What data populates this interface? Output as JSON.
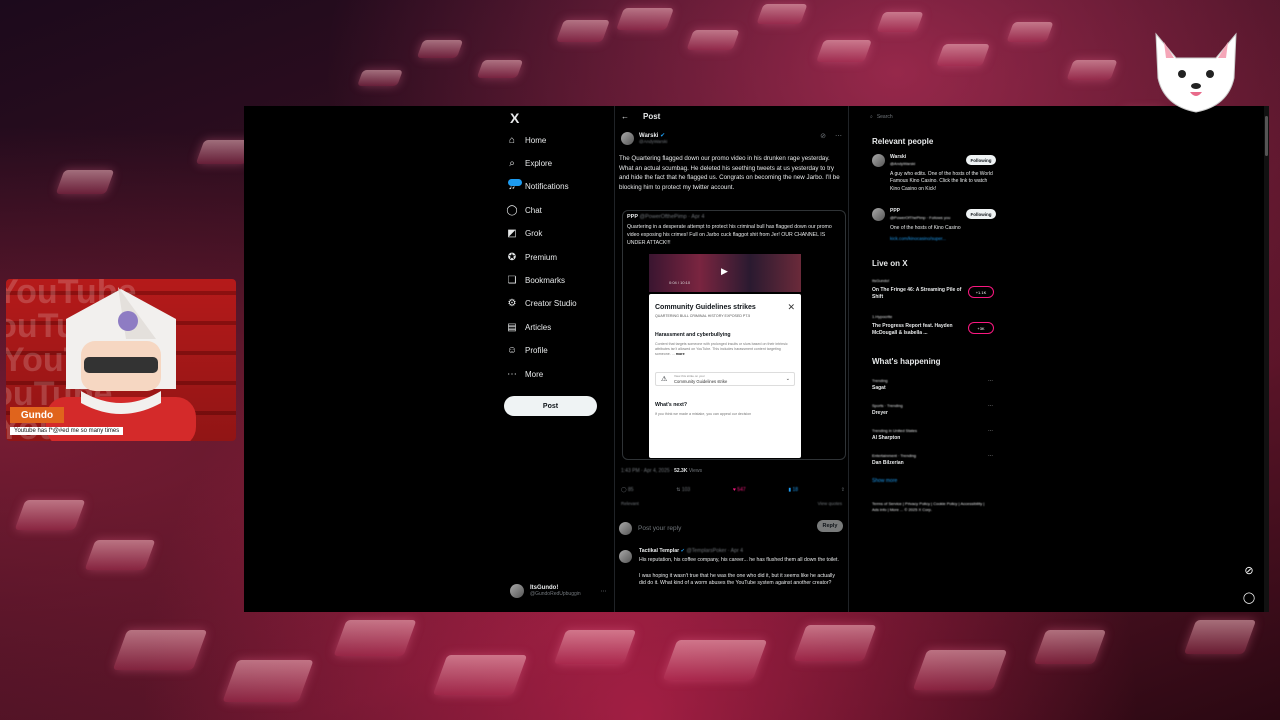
{
  "nav": {
    "logo": "X",
    "items": [
      {
        "label": "Home",
        "icon": "home-icon",
        "glyph": "⌂"
      },
      {
        "label": "Explore",
        "icon": "search-icon",
        "glyph": "⌕"
      },
      {
        "label": "Notifications",
        "icon": "bell-icon",
        "glyph": "♫"
      },
      {
        "label": "Chat",
        "icon": "chat-icon",
        "glyph": "◯"
      },
      {
        "label": "Grok",
        "icon": "grok-icon",
        "glyph": "◩"
      },
      {
        "label": "Premium",
        "icon": "premium-icon",
        "glyph": "✪"
      },
      {
        "label": "Bookmarks",
        "icon": "bookmark-icon",
        "glyph": "❏"
      },
      {
        "label": "Creator Studio",
        "icon": "creator-studio-icon",
        "glyph": "⚙"
      },
      {
        "label": "Articles",
        "icon": "articles-icon",
        "glyph": "▤"
      },
      {
        "label": "Profile",
        "icon": "profile-icon",
        "glyph": "☺"
      },
      {
        "label": "More",
        "icon": "more-icon",
        "glyph": "⋯"
      }
    ],
    "post_label": "Post",
    "account_name": "ItsGundo!",
    "account_handle": "@GundoRedUpbuggin"
  },
  "post": {
    "header": "Post",
    "author_name": "Warski",
    "author_handle": "@AndyWarski",
    "text": "The Quartering flagged down our promo video in his drunken rage yesterday. What an actual scumbag. He deleted his seething tweets at us yesterday to try and hide the fact that he flagged us. Congrats on becoming the new Jarbo. I'll be blocking him to protect my twitter account.",
    "quote_author": "PPP",
    "quote_handle": "@PowerOfthePimp · Apr 4",
    "quote_text": "Quartering in a desperate attempt to protect his criminal bull has flagged down our promo video exposing his crimes! Full on Jarbo cuck flaggot shit from Jer! OUR CHANNEL IS UNDER ATTACK!!!",
    "video_time": "0:04 / 10:10",
    "modal_title": "Community Guidelines strikes",
    "modal_subtitle": "QUARTERING BULL CRIMINAL HISTORY EXPOSED PT.5",
    "modal_section": "Harassment and cyberbullying",
    "modal_body": "Content that targets someone with prolonged insults or slurs based on their intrinsic attributes isn't allowed on YouTube. This includes harassment content targeting someone. ...",
    "modal_more": "more",
    "strike_label": "Community Guidelines strike",
    "strike_sublabel": "View this strike on your",
    "whats_next": "What's next?",
    "whats_next_body": "If you think we made a mistake, you can appeal our decision",
    "timestamp": "1:43 PM · Apr 4, 2025 · ",
    "views": "52.3K",
    "views_label": "Views",
    "stats": {
      "replies": "85",
      "reposts": "103",
      "likes": "547",
      "bookmarks": "18"
    },
    "relevant": "Relevant",
    "view_quotes": "View quotes",
    "reply_placeholder": "Post your reply",
    "reply_label": "Reply"
  },
  "reply": {
    "author": "Tactikal Templar",
    "handle": "@TemplarsPoker · Apr 4",
    "line1": "His reputation, his coffee company, his career... he has flushed them all down the toilet.",
    "line2": "I was hoping it wasn't true that he was the one who did it, but it seems like he actually did do it. What kind of a worm abuses the YouTube system against another creator?"
  },
  "sidebar": {
    "search_placeholder": "Search",
    "relevant_title": "Relevant people",
    "people": [
      {
        "name": "Warski",
        "handle": "@AndyWarski",
        "bio": "A guy who edits. One of the hosts of the World Famous Kino Casino. Click the link to watch Kino Casino on Kick!",
        "button": "Following"
      },
      {
        "name": "PPP",
        "handle": "@PowerOfThePimp · Follows you",
        "bio": "One of the hosts of Kino Casino",
        "link": "kick.com/kinocasino/super...",
        "button": "Following"
      }
    ],
    "live_title": "Live on X",
    "live": [
      {
        "host": "ItsGundo!",
        "title": "On The Fringe 46: A Streaming Pile of Shift",
        "count": "+1.1K"
      },
      {
        "host": "1.Hypocrite",
        "title": "The Progress Report feat. Hayden McDougall & Isabella ...",
        "count": "+3K"
      }
    ],
    "happening_title": "What's happening",
    "trends": [
      {
        "context": "Trending",
        "name": "Sagat"
      },
      {
        "context": "Sports · Trending",
        "name": "Dreyer"
      },
      {
        "context": "Trending in United States",
        "name": "Al Sharpton"
      },
      {
        "context": "Entertainment · Trending",
        "name": "Dan Bilzerian"
      }
    ],
    "show_more": "Show more",
    "footer": "Terms of Service | Privacy Policy | Cookie Policy | Accessibility | Ads info | More ... © 2025 X Corp."
  },
  "overlay": {
    "streamer_name": "Gundo",
    "caption": "Youtube has f*@#ed me so many times",
    "bg_word": "YouTube"
  },
  "colors": {
    "accent": "#1d9bf0",
    "like": "#f91880",
    "name_tag": "#e0641c"
  }
}
